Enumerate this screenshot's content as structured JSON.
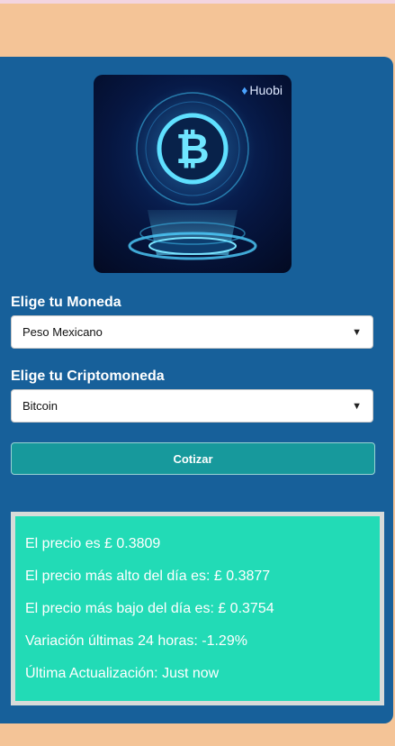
{
  "hero": {
    "brand_label": "Huobi"
  },
  "form": {
    "currency_label": "Elige tu Moneda",
    "currency_value": "Peso Mexicano",
    "crypto_label": "Elige tu Criptomoneda",
    "crypto_value": "Bitcoin",
    "submit_label": "Cotizar"
  },
  "result": {
    "price": "El precio es £ 0.3809",
    "high": "El precio más alto del día es: £ 0.3877",
    "low": "El precio más bajo del día es: £ 0.3754",
    "change": "Variación últimas 24 horas: -1.29%",
    "updated": "Última Actualización: Just now"
  },
  "colors": {
    "page_bg": "#f4c497",
    "card_bg": "#17609a",
    "button_bg": "#17999c",
    "result_bg": "#22dbb6"
  },
  "icons": [
    "bitcoin-hologram-icon",
    "huobi-flame-icon",
    "chevron-down-icon"
  ]
}
